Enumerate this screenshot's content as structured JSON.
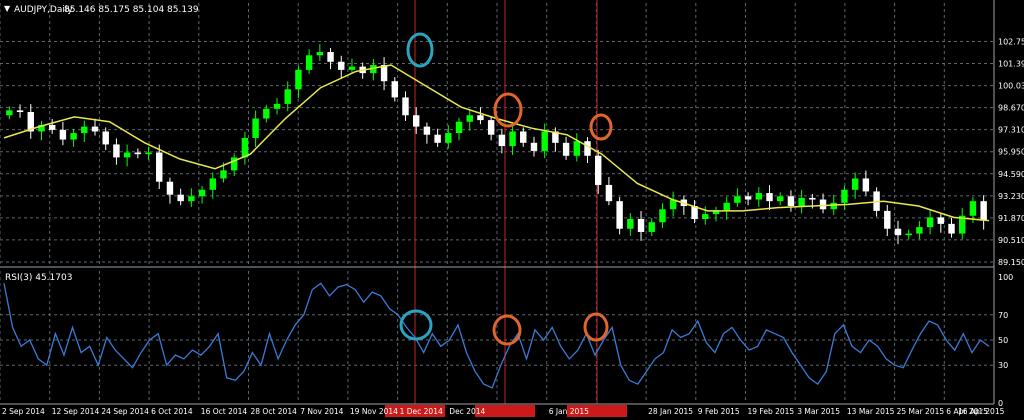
{
  "header": {
    "symbol": "AUDJPY,Daily",
    "ohlc": "85.146 85.175 85.104 85.139"
  },
  "rsi_label": "RSI(3) 45.1703",
  "chart_data": [
    {
      "type": "candlestick",
      "title": "AUDJPY,Daily",
      "ylim": [
        88.9,
        104.2
      ],
      "grid": true,
      "colors": {
        "up": "#00ff00",
        "down": "#ffffff",
        "ma": "#e8e84c",
        "grid": "#5a6670",
        "marker": "#a02020"
      },
      "y_ticks": [
        "102.750",
        "101.390",
        "100.030",
        "98.670",
        "97.310",
        "95.950",
        "94.590",
        "93.230",
        "91.870",
        "90.510",
        "89.150"
      ],
      "x_labels": [
        "2 Sep 2014",
        "12 Sep 2014",
        "24 Sep 2014",
        "6 Oct 2014",
        "16 Oct 2014",
        "28 Oct 2014",
        "7 Nov 2014",
        "19 Nov 2014",
        "1 Dec 2014",
        "Dec 2014",
        "",
        "6 Jan 2015",
        "",
        "28 Jan 2015",
        "9 Feb 2015",
        "19 Feb 2015",
        "3 Mar 2015",
        "13 Mar 2015",
        "25 Mar 2015",
        "6 Apr 2015",
        "16 Apr 2015"
      ],
      "ma": [
        96.8,
        97.5,
        98.1,
        97.8,
        96.5,
        95.5,
        94.9,
        95.8,
        98.0,
        99.9,
        100.9,
        101.3,
        100.0,
        98.7,
        98.0,
        97.4,
        97.0,
        95.8,
        94.0,
        93.0,
        92.3,
        92.3,
        92.5,
        92.6,
        92.7,
        92.9,
        92.6,
        91.9,
        91.7
      ],
      "closes": [
        98.5,
        98.4,
        97.2,
        97.6,
        97.3,
        96.7,
        97.1,
        97.5,
        97.2,
        96.4,
        95.6,
        95.9,
        95.8,
        95.9,
        94.1,
        93.3,
        92.9,
        93.2,
        93.6,
        94.3,
        94.8,
        95.6,
        96.8,
        98.0,
        98.6,
        98.9,
        99.8,
        101.0,
        101.9,
        102.1,
        101.5,
        101.0,
        101.2,
        100.8,
        101.3,
        100.3,
        99.3,
        98.2,
        97.5,
        97.0,
        96.5,
        97.1,
        97.8,
        98.2,
        97.9,
        97.0,
        96.3,
        97.2,
        96.5,
        96.0,
        97.2,
        96.5,
        95.7,
        96.6,
        95.7,
        93.9,
        92.9,
        91.2,
        91.8,
        91.0,
        91.6,
        92.4,
        93.0,
        92.6,
        91.8,
        92.1,
        92.3,
        92.8,
        93.2,
        93.0,
        93.4,
        92.9,
        93.2,
        92.6,
        93.1,
        93.0,
        92.4,
        92.8,
        93.6,
        94.3,
        93.5,
        92.3,
        91.2,
        90.8,
        90.9,
        91.3,
        91.9,
        91.5,
        90.9,
        92.0,
        92.9,
        91.7
      ]
    },
    {
      "type": "line",
      "title": "RSI(3) 45.1703",
      "ylim": [
        0,
        100
      ],
      "y_ticks": [
        100,
        70,
        50,
        30,
        0
      ],
      "grid": true,
      "color": "#3a7bd5",
      "values": [
        95,
        60,
        45,
        50,
        35,
        30,
        55,
        38,
        60,
        40,
        45,
        30,
        52,
        42,
        35,
        28,
        40,
        50,
        55,
        30,
        38,
        35,
        42,
        38,
        45,
        55,
        20,
        18,
        25,
        40,
        30,
        55,
        35,
        50,
        62,
        70,
        90,
        95,
        85,
        92,
        94,
        90,
        80,
        88,
        85,
        75,
        70,
        60,
        52,
        40,
        55,
        45,
        50,
        62,
        40,
        25,
        15,
        12,
        30,
        45,
        55,
        35,
        58,
        50,
        60,
        45,
        35,
        42,
        55,
        38,
        50,
        60,
        30,
        18,
        15,
        25,
        35,
        40,
        58,
        52,
        55,
        65,
        48,
        40,
        55,
        60,
        50,
        42,
        45,
        58,
        55,
        52,
        40,
        30,
        20,
        15,
        25,
        55,
        62,
        45,
        40,
        50,
        45,
        35,
        30,
        28,
        42,
        55,
        65,
        62,
        50,
        42,
        55,
        40,
        50,
        45
      ]
    }
  ]
}
